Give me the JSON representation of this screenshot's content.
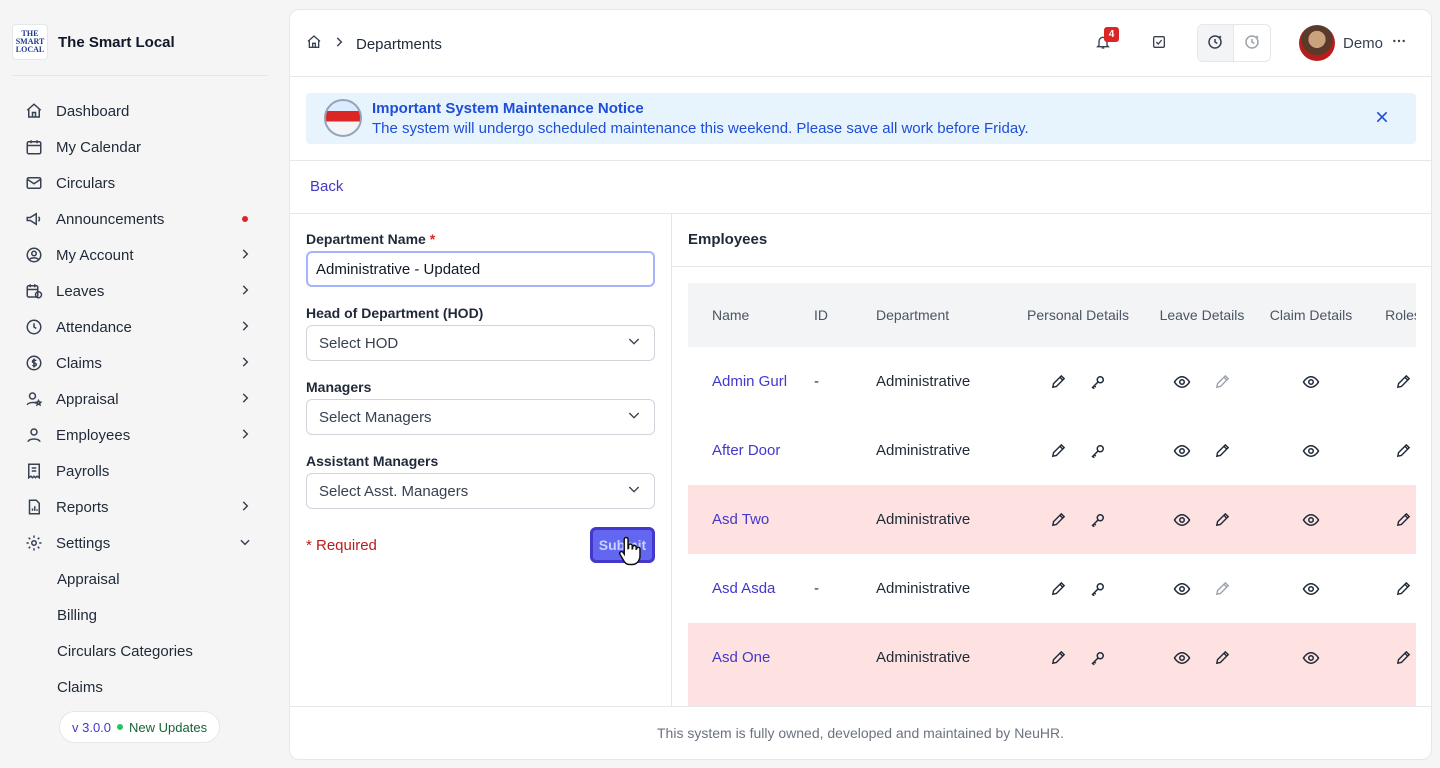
{
  "brand": {
    "name": "The Smart Local",
    "logo_lines": [
      "THE",
      "SMART",
      "LOCAL"
    ]
  },
  "sidebar": {
    "items": [
      {
        "label": "Dashboard",
        "icon": "home-icon",
        "chevron": false
      },
      {
        "label": "My Calendar",
        "icon": "calendar-icon",
        "chevron": false
      },
      {
        "label": "Circulars",
        "icon": "mail-icon",
        "chevron": false
      },
      {
        "label": "Announcements",
        "icon": "megaphone-icon",
        "chevron": false,
        "dot": true
      },
      {
        "label": "My Account",
        "icon": "user-circle-icon",
        "chevron": true
      },
      {
        "label": "Leaves",
        "icon": "calendar-clock-icon",
        "chevron": true
      },
      {
        "label": "Attendance",
        "icon": "clock-icon",
        "chevron": true
      },
      {
        "label": "Claims",
        "icon": "dollar-icon",
        "chevron": true
      },
      {
        "label": "Appraisal",
        "icon": "user-star-icon",
        "chevron": true
      },
      {
        "label": "Employees",
        "icon": "user-icon",
        "chevron": true
      },
      {
        "label": "Payrolls",
        "icon": "receipt-icon",
        "chevron": false
      },
      {
        "label": "Reports",
        "icon": "file-chart-icon",
        "chevron": true
      },
      {
        "label": "Settings",
        "icon": "gear-icon",
        "chevron": true,
        "expanded": true
      }
    ],
    "sub_items": [
      "Appraisal",
      "Billing",
      "Circulars Categories",
      "Claims"
    ],
    "version": "v 3.0.0",
    "updates": "New Updates"
  },
  "header": {
    "breadcrumb": "Departments",
    "notification_count": "4",
    "user_name": "Demo"
  },
  "notice": {
    "title": "Important System Maintenance Notice",
    "text": "The system will undergo scheduled maintenance this weekend. Please save all work before Friday."
  },
  "back_label": "Back",
  "form": {
    "dept_label": "Department Name",
    "dept_value": "Administrative - Updated",
    "hod_label": "Head of Department (HOD)",
    "hod_placeholder": "Select HOD",
    "managers_label": "Managers",
    "managers_placeholder": "Select Managers",
    "asst_label": "Assistant Managers",
    "asst_placeholder": "Select Asst. Managers",
    "required_note": "* Required",
    "submit_label": "Submit"
  },
  "employees": {
    "title": "Employees",
    "columns": [
      "Name",
      "ID",
      "Department",
      "Personal Details",
      "Leave Details",
      "Claim Details",
      "Roles"
    ],
    "rows": [
      {
        "name": "Admin Gurl",
        "id": "-",
        "department": "Administrative",
        "highlight": false,
        "leave_edit_disabled": true
      },
      {
        "name": "After Door",
        "id": "",
        "department": "Administrative",
        "highlight": false,
        "leave_edit_disabled": false
      },
      {
        "name": "Asd Two",
        "id": "",
        "department": "Administrative",
        "highlight": true,
        "leave_edit_disabled": false
      },
      {
        "name": "Asd Asda",
        "id": "-",
        "department": "Administrative",
        "highlight": false,
        "leave_edit_disabled": true
      },
      {
        "name": "Asd One",
        "id": "",
        "department": "Administrative",
        "highlight": true,
        "leave_edit_disabled": false
      },
      {
        "name": "",
        "id": "",
        "department": "",
        "highlight": true,
        "leave_edit_disabled": false
      }
    ]
  },
  "footer": "This system is fully owned, developed and maintained by NeuHR."
}
